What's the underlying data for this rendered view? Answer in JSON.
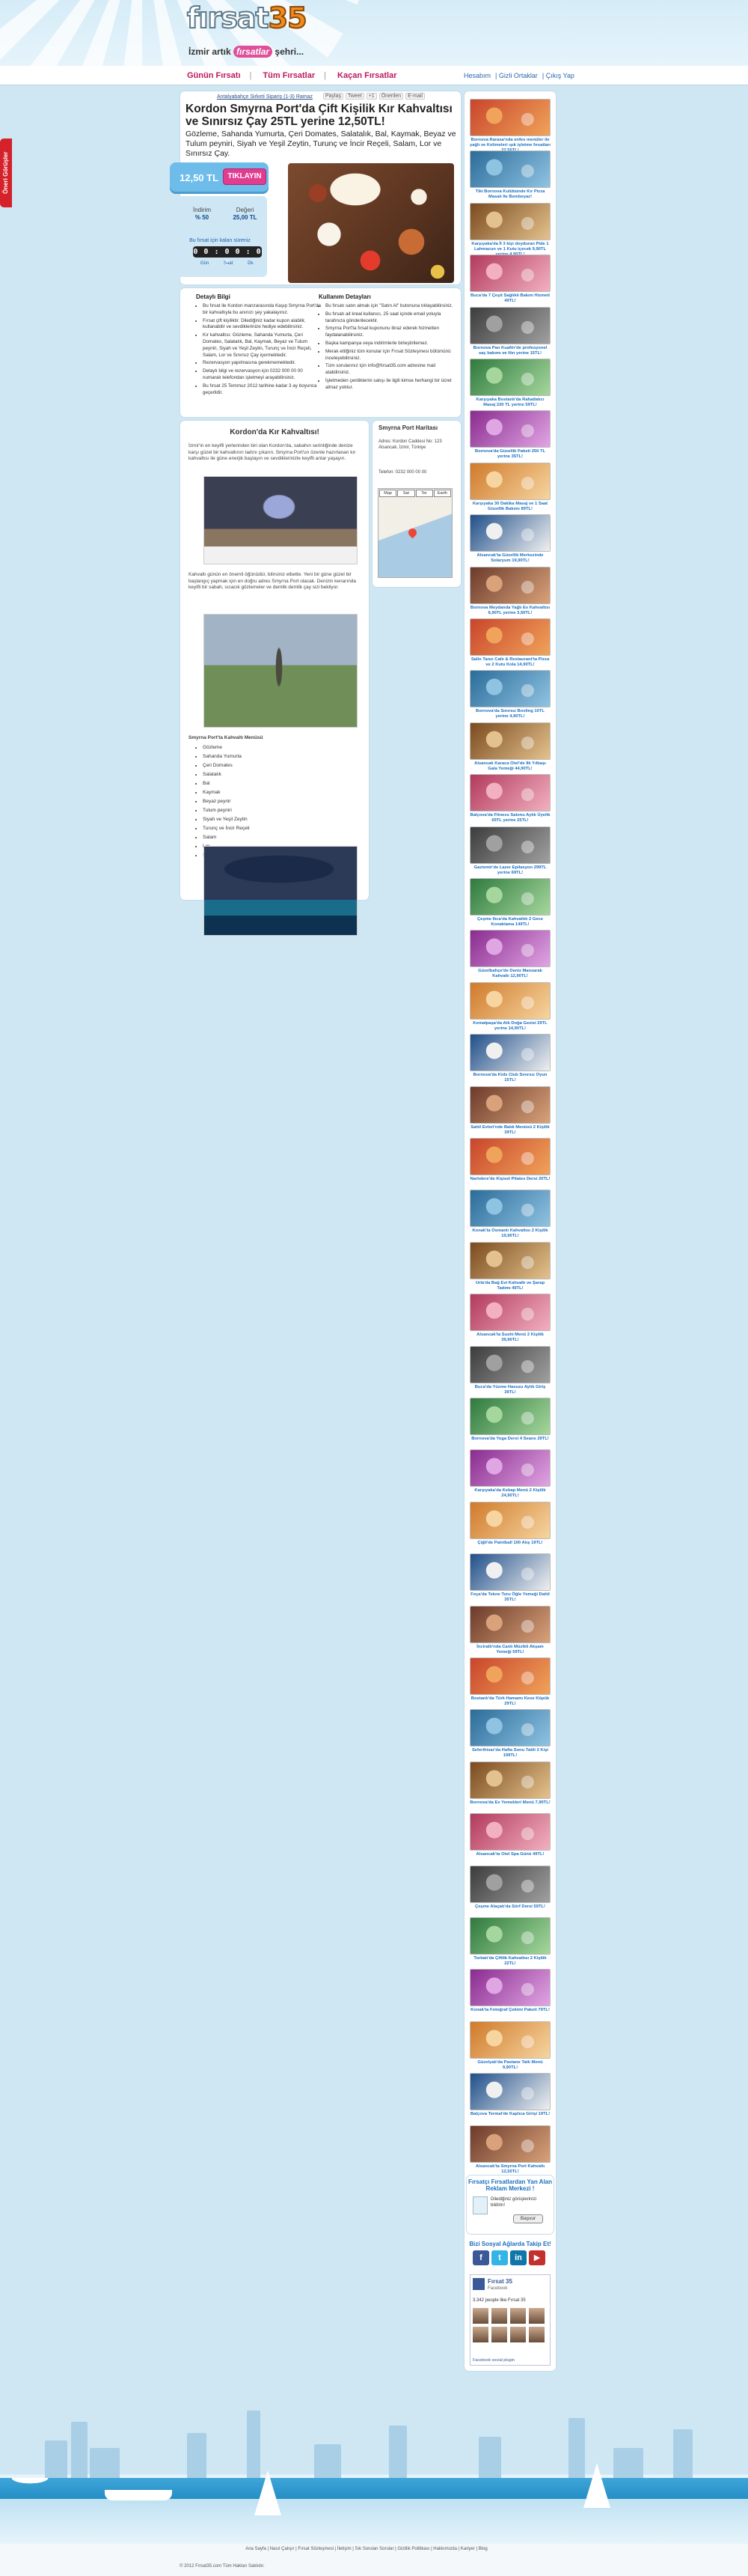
{
  "header": {
    "logo_text_a": "fırsat",
    "logo_text_b": "35",
    "tagline_a": "İzmir artık",
    "tagline_b": "fırsatlar",
    "tagline_c": "şehri..."
  },
  "nav": {
    "items": [
      "Günün Fırsatı",
      "Tüm Fırsatlar",
      "Kaçan Fırsatlar"
    ],
    "top_links": [
      "Hesabım",
      "Gizli Ortaklar",
      "Çıkış Yap"
    ]
  },
  "feedback_label": "Öneri Görüşler",
  "deal": {
    "breadcrumb": "Antalyabahçe Sirketi Sipariş (1-3) Ramaz",
    "share": [
      "Paylaş",
      "Tweet",
      "+1",
      "Önerilen",
      "E-mail"
    ],
    "title": "Kordon Smyrna Port'da Çift Kişilik Kır Kahvaltısı ve Sınırsız Çay 25TL yerine 12,50TL!",
    "description": "Gözleme, Sahanda Yumurta, Çeri Domates, Salatalık, Bal, Kaymak, Beyaz ve Tulum peyniri, Siyah ve Yeşil Zeytin, Turunç ve İncir Reçeli, Salam, Lor ve Sınırsız Çay.",
    "price": "12,50 TL",
    "buy_label": "TIKLAYIN",
    "discount_label": "İndirim",
    "discount_value": "% 50",
    "value_label": "Değeri",
    "value_value": "25,00 TL",
    "timer_label": "Bu fırsat için kalan süreniz",
    "timer": "0 0 : 0 0 : 0 0",
    "timer_units": [
      "Gün",
      "Saat",
      "Dk."
    ]
  },
  "details": {
    "left_title": "Detaylı Bilgi",
    "left_items": [
      "Bu fırsat ile Kordon manzarasında Kaşıp Smyrna Port'da bir kahvaltıyla bu anınızı şey yakalayınız.",
      "Fırsat çift kişiliktir. Dilediğiniz kadar kupon alabilir, kullanabilir ve sevdiklerinize hediye edebilirsiniz.",
      "Kır kahvaltısı: Gözleme, Sahanda Yumurta, Çeri Domates, Salatalık, Bal, Kaymak, Beyaz ve Tulum peyniri, Siyah ve Yeşil Zeytin, Turunç ve İncir Reçeli, Salam, Lor ve Sınırsız Çay içermektedir.",
      "Rezervasyon yapılmasına gerekmemektedir.",
      "Detaylı bilgi ve rezervasyon için 0232 000 00 00 numaralı telefondan işletmeyi arayabilirsiniz.",
      "Bu fırsat 25 Temmuz 2012 tarihine kadar 3 ay boyunca geçerlidir."
    ],
    "right_title": "Kullanım Detayları",
    "right_items": [
      "Bu fırsatı satın almak için \"Satın Al\" butonuna tıklayabilirsiniz.",
      "Bu fırsatı ait kreal kullanıcı, 25 saat içinde email yoluyla tarafınıza gönderilecektir.",
      "Smyrna Port'ta fırsat kuponunu ibraz ederek hizmetten faydalanabilirsiniz.",
      "Başka kampanya veya indirimlerle birleştirilemez.",
      "Merak ettiğiniz tüm konular için Fırsat Sözleşmesi bölümünü inceleyebilirsiniz.",
      "Tüm sorularınız için info@fırsat35.com adresine mail atabilirsiniz.",
      "İşletmeden çerdiklerini satışı ile ilgili kimse herhangi bir ücret almaz yoktur."
    ]
  },
  "map": {
    "title": "Smyrna Port Haritası",
    "address": "Adres: Kordon Caddesi No: 123 Alsancak, İzmir, Türkiye",
    "phone": "Telefon: 0232 000 00 00",
    "tabs": [
      "Map",
      "Sat",
      "Ter",
      "Earth"
    ]
  },
  "article": {
    "title": "Kordon'da Kır Kahvaltısı!",
    "p1": "İzmir'in en keyifli yerlerinden biri olan Kordon'da, sabahın serinliğinde denize karşı güzel bir kahvaltının tadını çıkarın. Smyrna Port'un özenle hazırlanan kır kahvaltısı ile güne enerjik başlayın ve sevdiklerinizle keyifli anlar yaşayın.",
    "p2": "Kahvaltı günün en önemli öğünüdür, bilirsiniz elbette. Yeni bir güne güzel bir başlangıç yapmak için en doğru adres Smyrna Port olacak. Denizin kenarında keyifli bir sabah, sıcacık gözlemeler ve demlik demlik çay sizi bekliyor.",
    "list_title": "Smyrna Port'ta Kahvaltı Menüsü",
    "list": [
      "Gözleme",
      "Sahanda Yumurta",
      "Çeri Domates",
      "Salatalık",
      "Bal",
      "Kaymak",
      "Beyaz peynir",
      "Tulum peyniri",
      "Siyah ve Yeşil Zeytin",
      "Turunç ve İncir Reçeli",
      "Salam",
      "Lor",
      "Sınırsız Çay"
    ]
  },
  "sidebar": {
    "deals": [
      "Bornova Rarasa'nda enfes menüler ile yağlı ve Kelimeleri ışık işletme fırsatları 22,50TL!",
      "Tiki Bornova Kulübünde Kır Pizza Masalı Ile Bembeyaz!",
      "Karşıyaka'da İl 3 kişi doyduran Pide 1 Lahmacun ve 1 Kutu içecek 9,90TL yerine 4,90TL!",
      "Buca'da 7 Çeşit Sağlıklı Bakım Hizmeti 49TL!",
      "Bornova Pan Kuaför'de profesyonel saç bakımı ve fön yerine 15TL!",
      "Karşıyaka Bostanlı'da Rahatlatıcı Masaj 220 TL yerine 59TL!",
      "Bornova'da Güzellik Paketi 250 TL yerine 35TL!",
      "Karşıyaka 30 Dakika Masaj ve 1 Saat Güzellik Bakımı 89TL!",
      "Alsancak'ta Güzellik Merkezinde Solaryum 19,90TL!",
      "Bornova Meydanda Yağlı Ev Kahvaltısı 6,90TL yerine 3,50TL!",
      "Sallo Tanzı Cafe & Restaurant'ta Pizza ve 2 Kutu Kola 14,90TL!",
      "Bornova'da Sınırsız Bovling 10TL yerine 4,90TL!",
      "Alsancak Karaca Otel'de Ilk Yılbaşı Gala Yemeği 44,90TL!",
      "Balçova'da Fitness Salonu Aylık Üyelik 69TL yerine 25TL!",
      "Gaziemir'de Lazer Epilasyon 299TL yerine 69TL!",
      "Çeşme Ilıca'da Kahvaltılı 2 Gece Konaklama 149TL!",
      "Güzelbahçe'de Deniz Manzaralı Kahvaltı 12,90TL!",
      "Kemalpaşa'da Atlı Doğa Gezisi 29TL yerine 14,90TL!",
      "Bornova'da Kids Club Sınırsız Oyun 15TL!",
      "Sahil Evleri'nde Balık Menüsü 2 Kişilik 39TL!",
      "Narlıdere'de Kişisel Pilates Dersi 20TL!",
      "Konak'ta Osmanlı Kahvaltısı 2 Kişilik 19,90TL!",
      "Urla'da Bağ Evi Kahvaltı ve Şarap Tadımı 49TL!",
      "Alsancak'ta Sushi Menü 2 Kişilik 39,90TL!",
      "Buca'da Yüzme Havuzu Aylık Giriş 39TL!",
      "Bornova'da Yoga Dersi 4 Seans 29TL!",
      "Karşıyaka'da Kebap Menü 2 Kişilik 24,90TL!",
      "Çiğli'de Paintball 100 Atış 19TL!",
      "Foça'da Tekne Turu Öğle Yemeği Dahil 35TL!",
      "İnciraltı'nda Canlı Müzikli Akşam Yemeği 59TL!",
      "Bostanlı'da Türk Hamamı Kese Köpük 29TL!",
      "Seferihisar'da Hafta Sonu Tatili 2 Kişi 199TL!",
      "Bornova'da Ev Yemekleri Menü 7,90TL!",
      "Alsancak'ta Otel Spa Günü 49TL!",
      "Çeşme Alaçatı'da Sörf Dersi 59TL!",
      "Torbalı'da Çiftlik Kahvaltısı 2 Kişilik 22TL!",
      "Konak'ta Fotoğraf Çekimi Paketi 79TL!",
      "Güzelyalı'da Pastane Tatlı Menü 9,90TL!",
      "Balçova Termal'de Kaplıca Girişi 19TL!",
      "Alsancak'ta Smyrna Port Kahvaltı 12,50TL!"
    ],
    "newsletter_title": "Fırsatçı Fırsatlardan Yan Alan Reklam Merkezi !",
    "newsletter_text": "Dilediğiniz görüşlerinizi bildirin!",
    "newsletter_button": "Başvur",
    "social_title": "Bizi Sosyal Ağlarda Takip Et!",
    "social": [
      "f",
      "t",
      "in",
      "▶"
    ],
    "fb_name": "Fırsat 35",
    "fb_sub": "Facebook",
    "fb_like": "3.342 people like Fırsat 35",
    "fb_plugin": "Facebook social plugin"
  },
  "footer": {
    "links": "Ana Sayfa | Nasıl Çalışır | Fırsat Sözleşmesi | İletişim | Sık Sorulan Sorular | Gizlilik Politikası | Hakkımızda | Kariyer | Blog",
    "copyright": "© 2012 Fırsat35.com Tüm Hakları Saklıdır."
  }
}
